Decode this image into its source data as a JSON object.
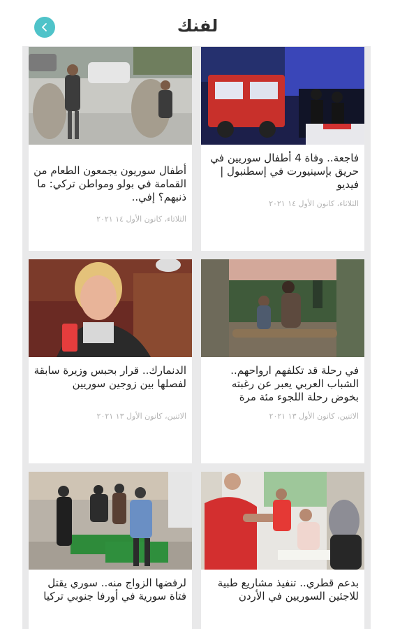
{
  "header": {
    "logo_text": "ﻟﻔﻨﻚ",
    "back_icon": "chevron-left-icon",
    "accent_color": "#4fc3c9"
  },
  "articles": [
    {
      "title": "أطفال سوريون يجمعون الطعام من القمامة في بولو ومواطن تركي: ما ذنبهم؟ إفي..",
      "date": "الثلاثاء، كانون الأول ١٤ ٢٠٢١"
    },
    {
      "title": "فاجعة.. وفاة 4 أطفال سوريين في حريق بإسينيورت في إسطنبول | فيديو",
      "date": "الثلاثاء، كانون الأول ١٤ ٢٠٢١"
    },
    {
      "title": "الدنمارك.. قرار بحبس وزيرة سابقة لفصلها بين زوجين سوريين",
      "date": "الاثنين، كانون الأول ١٣ ٢٠٢١"
    },
    {
      "title": "في رحلة قد تكلفهم ارواحهم.. الشباب العربي يعبر عن رغبته بخوض رحلة اللجوء مئة مرة",
      "date": "الاثنين، كانون الأول ١٣ ٢٠٢١"
    },
    {
      "title": "لرفضها الزواج منه.. سوري يقتل فتاة سورية في أورفا جنوبي تركيا",
      "date": ""
    },
    {
      "title": "بدعم قطري.. تنفيذ مشاريع طبية للاجئين السوريين في الأردن",
      "date": ""
    }
  ]
}
